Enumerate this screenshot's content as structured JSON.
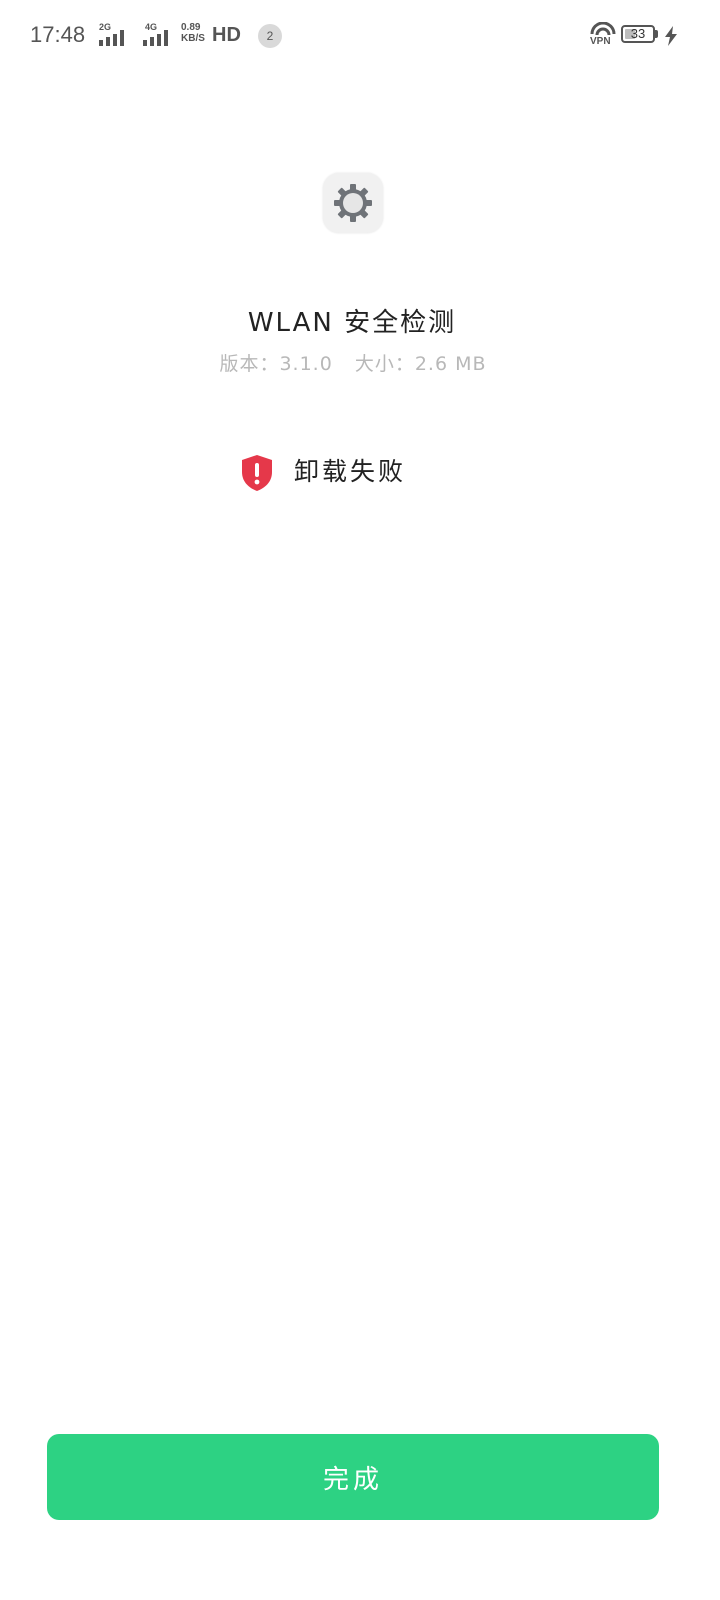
{
  "status_bar": {
    "time": "17:48",
    "signal_1_type": "2G",
    "signal_2_type": "4G",
    "speed_value": "0.89",
    "speed_unit": "KB/S",
    "hd_label": "HD",
    "notification_count": "2",
    "vpn_label": "VPN",
    "battery_level": "33",
    "icons": [
      "signal-icon",
      "signal-icon",
      "vpn-icon",
      "battery-icon",
      "charging-icon"
    ]
  },
  "app": {
    "icon": "gear-icon",
    "name": "WLAN 安全检测",
    "version_label": "版本：3.1.0",
    "size_label": "大小：2.6 MB"
  },
  "result": {
    "icon": "shield-alert-icon",
    "text": "卸载失败",
    "color": "#e5384a"
  },
  "actions": {
    "done_label": "完成",
    "done_color": "#2dd283"
  }
}
